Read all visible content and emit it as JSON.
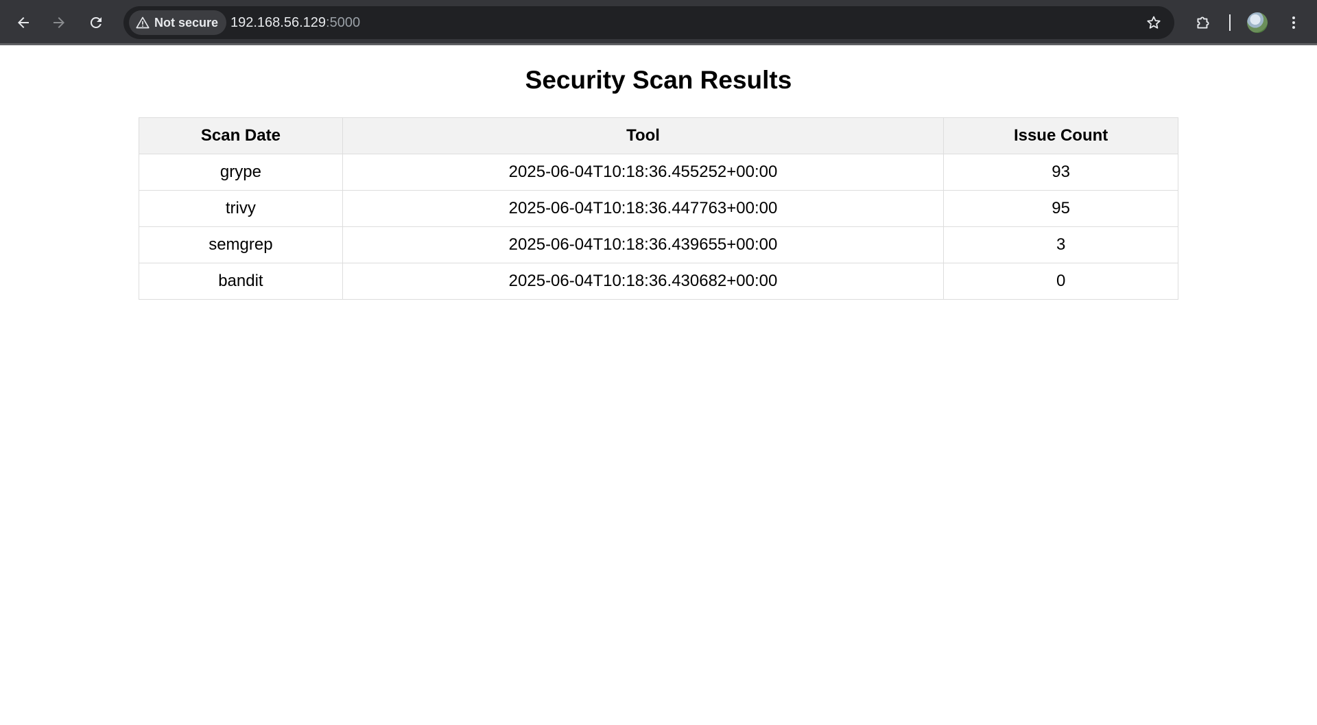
{
  "browser": {
    "security_label": "Not secure",
    "url_host": "192.168.56.129",
    "url_port": ":5000"
  },
  "page": {
    "title": "Security Scan Results",
    "table": {
      "headers": [
        "Scan Date",
        "Tool",
        "Issue Count"
      ],
      "rows": [
        [
          "grype",
          "2025-06-04T10:18:36.455252+00:00",
          "93"
        ],
        [
          "trivy",
          "2025-06-04T10:18:36.447763+00:00",
          "95"
        ],
        [
          "semgrep",
          "2025-06-04T10:18:36.439655+00:00",
          "3"
        ],
        [
          "bandit",
          "2025-06-04T10:18:36.430682+00:00",
          "0"
        ]
      ]
    }
  },
  "icons": {
    "back": "back-arrow-icon",
    "forward": "forward-arrow-icon",
    "reload": "reload-icon",
    "warning": "warning-triangle-icon",
    "bookmark": "star-icon",
    "extensions": "puzzle-icon",
    "profile": "avatar",
    "menu": "kebab-menu-icon"
  },
  "colors": {
    "toolbar": "#35363a",
    "omnibox": "#202124",
    "header_bg": "#f2f2f2",
    "border": "#dddddd"
  }
}
